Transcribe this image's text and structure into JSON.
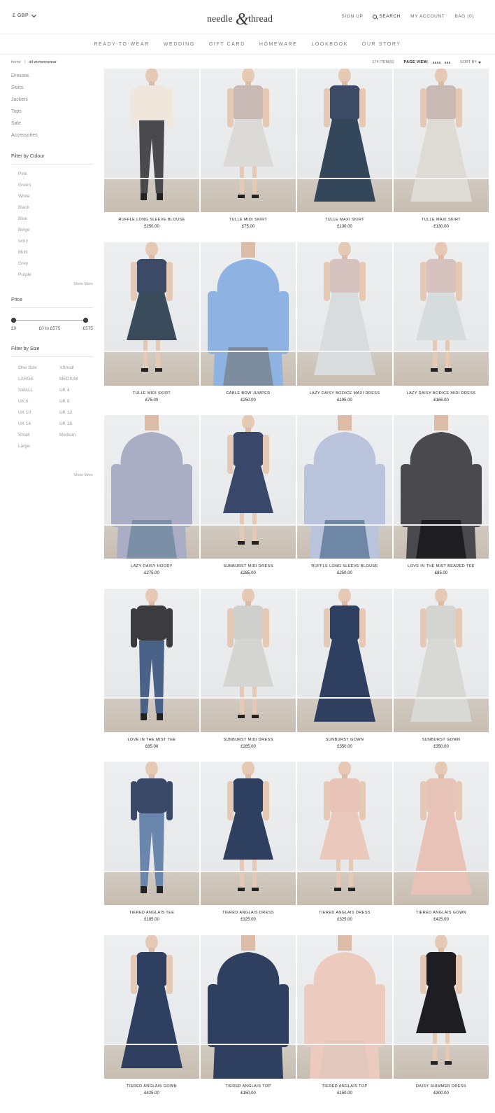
{
  "header": {
    "currency": "£ GBP",
    "logo_left": "needle",
    "logo_amp": "&",
    "logo_right": "thread",
    "links": {
      "signup": "SIGN UP",
      "search": "SEARCH",
      "account": "MY ACCOUNT",
      "bag": "BAG (0)"
    }
  },
  "nav": [
    "READY-TO-WEAR",
    "WEDDING",
    "GIFT CARD",
    "HOMEWARE",
    "LOOKBOOK",
    "OUR STORY"
  ],
  "breadcrumb": {
    "home": "home",
    "sep": "\\",
    "current": "all womenswear"
  },
  "toolbar": {
    "count": "174 ITEM(S)",
    "page_view": "PAGE VIEW:",
    "sort": "SORT BY"
  },
  "sidebar": {
    "categories": [
      "Dresses",
      "Skirts",
      "Jackets",
      "Tops",
      "Sale",
      "Accessories"
    ],
    "colour_title": "Filter by Colour",
    "colours": [
      "Pink",
      "Green",
      "White",
      "Black",
      "Blue",
      "Beige",
      "Ivory",
      "Multi",
      "Grey",
      "Purple"
    ],
    "show_more": "Show More",
    "price_title": "Price",
    "price_min": "£0",
    "price_range": "£0 to £575",
    "price_max": "£575",
    "size_title": "Filter by Size",
    "sizes": [
      "One Size",
      "XSmall",
      "LARGE",
      "MEDIUM",
      "SMALL",
      "UK 4",
      "UK 6",
      "UK 8",
      "UK 10",
      "UK 12",
      "UK 14",
      "UK 16",
      "Small",
      "Medium",
      "Large"
    ]
  },
  "products": [
    {
      "name": "RUFFLE LONG SLEEVE BLOUSE",
      "price": "£250.00",
      "look": "top-jeans",
      "top": "#efe6dc",
      "bottom": "#4a4a4e"
    },
    {
      "name": "TULLE MIDI SKIRT",
      "price": "£75.00",
      "look": "midi",
      "top": "#c9b9b4",
      "bottom": "#dcdad6"
    },
    {
      "name": "TULLE MAXI SKIRT",
      "price": "£130.00",
      "look": "maxi",
      "top": "#3c4a66",
      "bottom": "#34465a"
    },
    {
      "name": "TULLE MAXI SKIRT",
      "price": "£130.00",
      "look": "maxi",
      "top": "#c9b9b4",
      "bottom": "#dedbd5"
    },
    {
      "name": "TULLE MIDI SKIRT",
      "price": "£75.00",
      "look": "midi",
      "top": "#3c4a66",
      "bottom": "#3a4c5c"
    },
    {
      "name": "CABLE BOW JUMPER",
      "price": "£250.00",
      "look": "closeup",
      "top": "#8eb3e2",
      "bottom": "#7d8c9e"
    },
    {
      "name": "LAZY DAISY BODICE MAXI DRESS",
      "price": "£195.00",
      "look": "maxi",
      "top": "#d6c3c0",
      "bottom": "#d8dcdc"
    },
    {
      "name": "LAZY DAISY BODICE MIDI DRESS",
      "price": "£165.00",
      "look": "midi",
      "top": "#d6c3c0",
      "bottom": "#d6dbdc"
    },
    {
      "name": "LAZY DAISY HOODY",
      "price": "£275.00",
      "look": "closeup",
      "top": "#a9aec4",
      "bottom": "#7b8fa6"
    },
    {
      "name": "SUNBURST MIDI DRESS",
      "price": "£285.00",
      "look": "midi",
      "top": "#39476a",
      "bottom": "#39476a"
    },
    {
      "name": "RUFFLE LONG SLEEVE BLOUSE",
      "price": "£250.00",
      "look": "closeup",
      "top": "#b9c3dc",
      "bottom": "#6f87a6"
    },
    {
      "name": "LOVE IN THE MIST BEADED TEE",
      "price": "£85.00",
      "look": "closeup",
      "top": "#4a4a4e",
      "bottom": "#1e1e20"
    },
    {
      "name": "LOVE IN THE MIST TEE",
      "price": "£85.00",
      "look": "top-jeans",
      "top": "#3c3c40",
      "bottom": "#4a6288"
    },
    {
      "name": "SUNBURST MIDI DRESS",
      "price": "£285.00",
      "look": "midi",
      "top": "#cfcfcd",
      "bottom": "#d4d4d0"
    },
    {
      "name": "SUNBURST GOWN",
      "price": "£350.00",
      "look": "maxi",
      "top": "#2f3f60",
      "bottom": "#2f3f60"
    },
    {
      "name": "SUNBURST GOWN",
      "price": "£350.00",
      "look": "maxi",
      "top": "#d4d4d0",
      "bottom": "#d8d8d4"
    },
    {
      "name": "TIERED ANGLAIS TEE",
      "price": "£185.00",
      "look": "top-jeans",
      "top": "#3a4968",
      "bottom": "#6a86ac"
    },
    {
      "name": "TIERED ANGLAIS DRESS",
      "price": "£325.00",
      "look": "midi",
      "top": "#2f3f60",
      "bottom": "#2f3f60"
    },
    {
      "name": "TIERED ANGLAIS DRESS",
      "price": "£325.00",
      "look": "midi",
      "top": "#e8c4b8",
      "bottom": "#eac8bc"
    },
    {
      "name": "TIERED ANGLAIS GOWN",
      "price": "£425.00",
      "look": "maxi",
      "top": "#e8c4b8",
      "bottom": "#e8c2b6"
    },
    {
      "name": "TIERED ANGLAIS GOWN",
      "price": "£425.00",
      "look": "maxi",
      "top": "#2f3f60",
      "bottom": "#2f3f60"
    },
    {
      "name": "TIERED ANGLAIS TOP",
      "price": "£150.00",
      "look": "closeup",
      "top": "#2f3f60",
      "bottom": "#2f3f60"
    },
    {
      "name": "TIERED ANGLAIS TOP",
      "price": "£150.00",
      "look": "closeup",
      "top": "#eccabe",
      "bottom": "#e2c8bc"
    },
    {
      "name": "DAISY SHIMMER DRESS",
      "price": "£300.00",
      "look": "midi",
      "top": "#1e1e22",
      "bottom": "#1e1e22"
    }
  ]
}
